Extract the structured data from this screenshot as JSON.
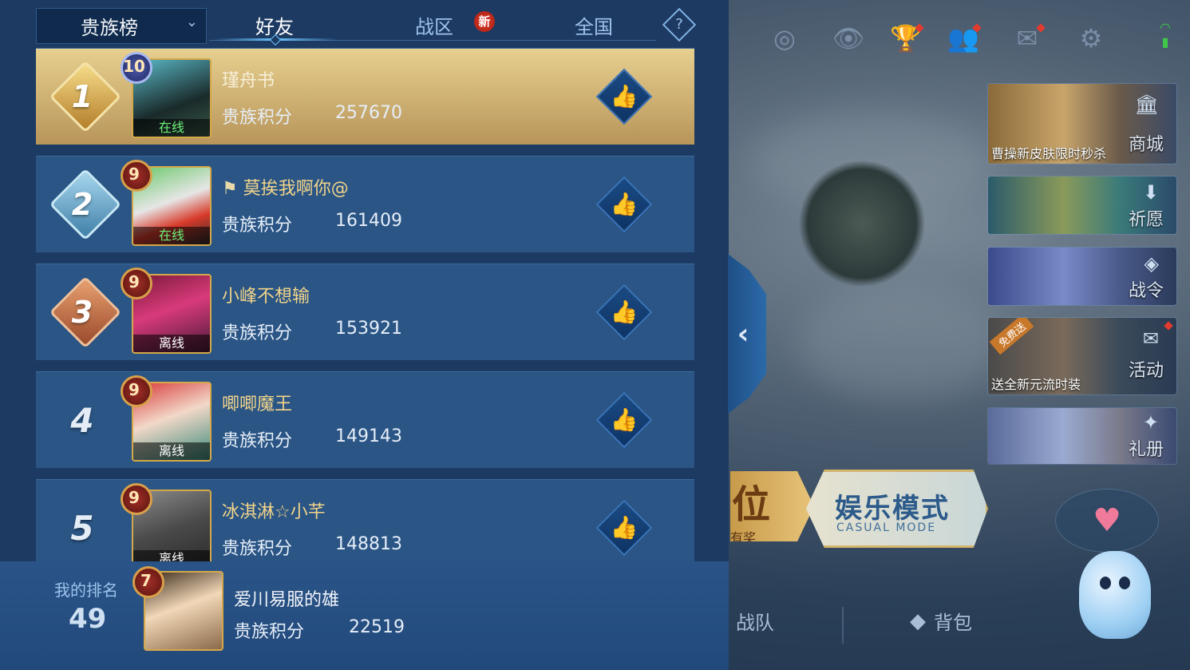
{
  "tabs": {
    "dropdown_label": "贵族榜",
    "friends": "好友",
    "zone": "战区",
    "zone_badge": "新",
    "national": "全国",
    "help": "?"
  },
  "leaderboard": [
    {
      "rank": "1",
      "level": "10",
      "name": "瑾舟书",
      "score_label": "贵族积分",
      "score": "257670",
      "status": "在线"
    },
    {
      "rank": "2",
      "level": "9",
      "name": "莫挨我啊你@",
      "score_label": "贵族积分",
      "score": "161409",
      "status": "在线"
    },
    {
      "rank": "3",
      "level": "9",
      "name": "小峰不想输",
      "score_label": "贵族积分",
      "score": "153921",
      "status": "离线"
    },
    {
      "rank": "4",
      "level": "9",
      "name": "唧唧魔王",
      "score_label": "贵族积分",
      "score": "149143",
      "status": "离线"
    },
    {
      "rank": "5",
      "level": "9",
      "name": "冰淇淋☆小芊",
      "score_label": "贵族积分",
      "score": "148813",
      "status": "离线"
    }
  ],
  "my_rank": {
    "label": "我的排名",
    "rank": "49",
    "level": "7",
    "name": "爱川易服的雄",
    "score_label": "贵族积分",
    "score": "22519"
  },
  "right_cards": {
    "shop": {
      "label": "商城",
      "caption": "曹操新皮肤限时秒杀"
    },
    "wish": {
      "label": "祈愿"
    },
    "battle_pass": {
      "label": "战令"
    },
    "events": {
      "label": "活动",
      "caption": "送全新元流时装",
      "ribbon": "免费送"
    },
    "gift_book": {
      "label": "礼册"
    }
  },
  "mode": {
    "ranked_partial": "位",
    "ranked_sub_partial": "有奖",
    "casual_title": "娱乐模式",
    "casual_sub": "CASUAL MODE"
  },
  "bottom_nav": {
    "team": "战队",
    "backpack": "背包"
  },
  "colors": {
    "panel": "#1d3a62",
    "row": "#2a5585",
    "first_row": "#d6b878",
    "name_gold": "#f2d48a",
    "online": "#6ef07a"
  }
}
